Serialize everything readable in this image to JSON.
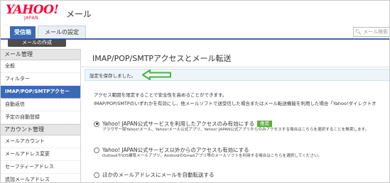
{
  "header": {
    "logo": "YAHOO!",
    "logo_sub": "JAPAN",
    "product": "メール"
  },
  "tabs": [
    {
      "label": "受信箱"
    },
    {
      "label": "メールの設定"
    }
  ],
  "search": {
    "placeholder": "メール検索"
  },
  "compose_label": "メールの作成",
  "sidebar": {
    "section1": "メール管理",
    "items1": [
      "全般",
      "フィルター",
      "IMAP/POP/SMTPアクセー",
      "自動返信",
      "予定の自動登録"
    ],
    "section2": "アカウント管理",
    "items2": [
      "メールアカウント",
      "メールアドレス変更",
      "セーフティーアドレス",
      "追加メールアドレス"
    ]
  },
  "main": {
    "title": "IMAP/POP/SMTPアクセスとメール転送",
    "notice": "設定を保存しました。",
    "desc1": "アクセス範囲を限定することで安全性を高めることができます。",
    "desc2": "IMAP/POP/SMTPのいずれかを有効にし、他メールソフトで送受信した場合またはメール転送機能を利用した場合「Yahoo!ダイレクトオ",
    "options": [
      {
        "label": "Yahoo! JAPAN公式サービスを利用したアクセスのみ有効にする",
        "badge": "推奨",
        "desc": "ブラウザー版Yahoo!メール、Yahoo!メール公式アプリ、Yahoo! JAPAN公式アプリからのみアクセスする場合はこちらを選択することを推奨します。",
        "checked": true
      },
      {
        "label": "Yahoo! JAPAN公式サービス以外からのアクセスも有効にする",
        "desc": "OutlookやiOS標準メールアプリ、AndroidのGmailアプリ等のメールソフトを利用する場合はこちらを選択してください。",
        "checked": false
      },
      {
        "label": "ほかのメールアドレスにメールを自動転送する",
        "checked": false
      }
    ]
  },
  "colors": {
    "brand_red": "#ff0033",
    "accent_blue": "#3b6ab5",
    "recommend_green": "#5fad3c",
    "arrow_green": "#3fb53f"
  }
}
